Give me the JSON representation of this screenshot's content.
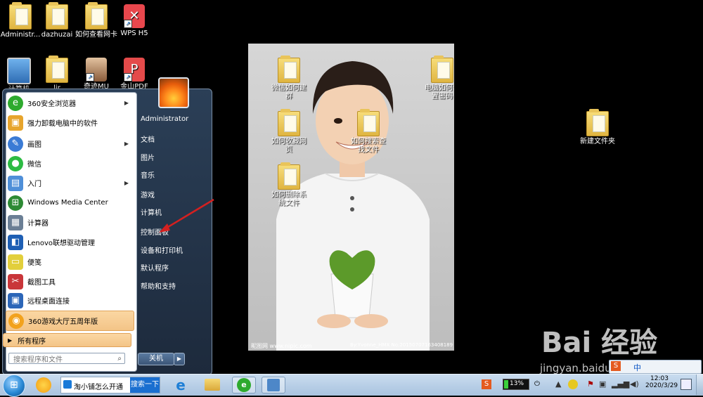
{
  "desktop": {
    "icons_top": [
      {
        "label": "Administr..."
      },
      {
        "label": "dazhuzai"
      },
      {
        "label": "如何查看网卡"
      },
      {
        "label": "WPS H5"
      }
    ],
    "icons_row2": [
      {
        "label": "计算机"
      },
      {
        "label": "lir"
      },
      {
        "label": "奇迹MU"
      },
      {
        "label": "金山PDF"
      }
    ],
    "right_folder": "新建文件夹"
  },
  "photo": {
    "folders": [
      {
        "label": "微信如何建群"
      },
      {
        "label": "电脑如何设置密码"
      },
      {
        "label": "如何收藏网页"
      },
      {
        "label": "如何搜索查找文件"
      },
      {
        "label": "如何删除系统文件"
      }
    ],
    "footer_left": "昵图网 www.nipic.com",
    "footer_right": "By:Yvonne_HMX No:20150707163408189"
  },
  "start_menu": {
    "left_items": [
      {
        "label": "360安全浏览器",
        "arrow": "▶",
        "color": "#2eaa2e"
      },
      {
        "label": "强力卸载电脑中的软件",
        "arrow": "",
        "color": "#e7a52d"
      },
      {
        "label": "画图",
        "arrow": "▶",
        "color": "#3a7bd5"
      },
      {
        "label": "微信",
        "arrow": "",
        "color": "#2dbb43"
      },
      {
        "label": "入门",
        "arrow": "▶",
        "color": "#4f8fd8"
      },
      {
        "label": "Windows Media Center",
        "arrow": "",
        "color": "#2d8a34"
      },
      {
        "label": "计算器",
        "arrow": "",
        "color": "#6b7f95"
      },
      {
        "label": "Lenovo联想驱动管理",
        "arrow": "",
        "color": "#1e5fb4"
      },
      {
        "label": "便笺",
        "arrow": "",
        "color": "#e2cf3c"
      },
      {
        "label": "截图工具",
        "arrow": "",
        "color": "#c9363a"
      },
      {
        "label": "远程桌面连接",
        "arrow": "",
        "color": "#2c66b8"
      },
      {
        "label": "360游戏大厅五周年版",
        "arrow": "",
        "color": "#f2a21d"
      }
    ],
    "all_programs": "所有程序",
    "search_placeholder": "搜索程序和文件",
    "right_items": [
      {
        "label": "Administrator"
      },
      {
        "label": "文档"
      },
      {
        "label": "图片"
      },
      {
        "label": "音乐"
      },
      {
        "label": "游戏"
      },
      {
        "label": "计算机"
      },
      {
        "label": "控制面板"
      },
      {
        "label": "设备和打印机"
      },
      {
        "label": "默认程序"
      },
      {
        "label": "帮助和支持"
      }
    ],
    "shutdown": "关机",
    "shutdown_arrow": "▶"
  },
  "taskbar": {
    "search_text": "淘小铺怎么开通",
    "search_button": "搜索一下",
    "battery": "13%",
    "ime": "中",
    "time": "12:03",
    "date": "2020/3/29"
  },
  "watermark": {
    "brand": "Bai 经验",
    "url": "jingyan.baidu.com"
  },
  "colors": {
    "annotation_arrow": "#d42020",
    "start_orb": "#2a8ad6"
  }
}
